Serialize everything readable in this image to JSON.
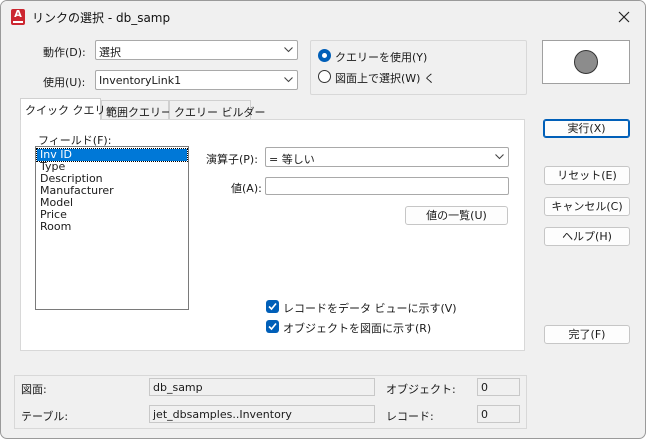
{
  "window": {
    "title": "リンクの選択 - db_samp",
    "app_icon_letter": "A"
  },
  "action": {
    "label": "動作(D):",
    "value": "選択"
  },
  "usage": {
    "label": "使用(U):",
    "value": "InventoryLink1"
  },
  "selection_mode": {
    "use_query_label": "クエリーを使用(Y)",
    "use_query_selected": true,
    "select_on_drawing_label": "図面上で選択(W) く",
    "select_on_drawing_selected": false
  },
  "tabs": [
    {
      "label": "クイック クエリー",
      "active": true
    },
    {
      "label": "範囲クエリー",
      "active": false
    },
    {
      "label": "クエリー ビルダー",
      "active": false
    }
  ],
  "quick_query": {
    "fields_label": "フィールド(F):",
    "fields": [
      "Inv ID",
      "Type",
      "Description",
      "Manufacturer",
      "Model",
      "Price",
      "Room"
    ],
    "selected_field": "Inv ID",
    "operator_label": "演算子(P):",
    "operator_value": "=   等しい",
    "value_label": "値(A):",
    "value_input": "",
    "value_list_button": "値の一覧(U)",
    "show_record_label": "レコードをデータ ビューに示す(V)",
    "show_record_checked": true,
    "show_objects_label": "オブジェクトを図面に示す(R)",
    "show_objects_checked": true
  },
  "buttons": {
    "execute": "実行(X)",
    "reset": "リセット(E)",
    "cancel": "キャンセル(C)",
    "help": "ヘルプ(H)",
    "done": "完了(F)"
  },
  "status": {
    "drawing_label": "図面:",
    "drawing_value": "db_samp",
    "table_label": "テーブル:",
    "table_value": "jet_dbsamples..Inventory",
    "object_label": "オブジェクト:",
    "object_value": "0",
    "record_label": "レコード:",
    "record_value": "0"
  },
  "colors": {
    "accent": "#005fb8",
    "selection": "#0078d7",
    "app_icon": "#cc2630"
  }
}
